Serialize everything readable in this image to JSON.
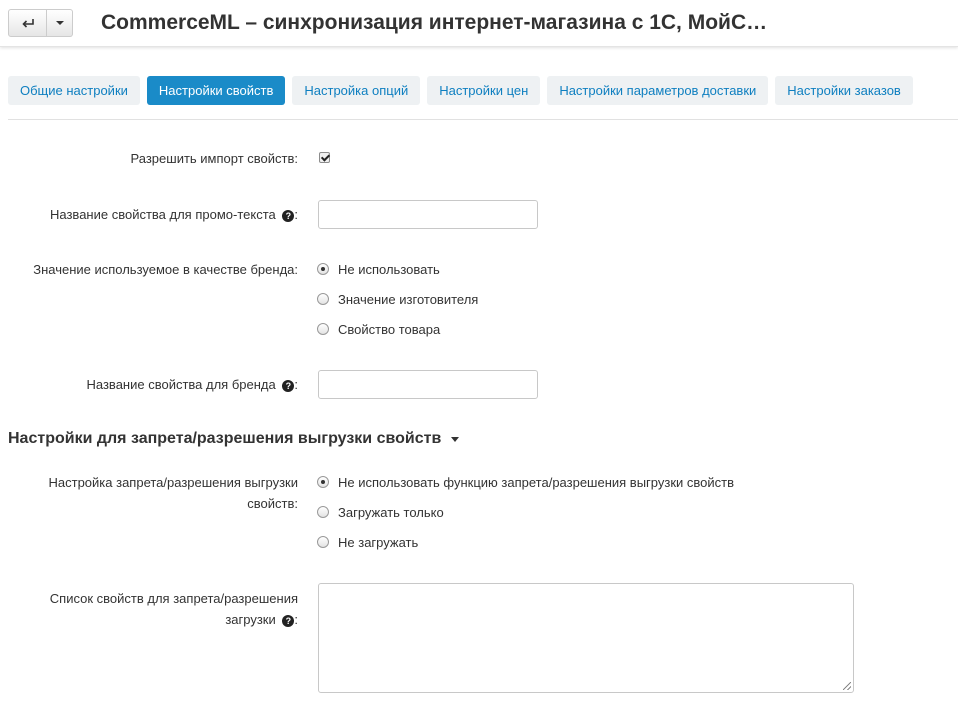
{
  "header": {
    "title": "CommerceML – синхронизация интернет-магазина с 1С, МойС…"
  },
  "tabs": [
    {
      "label": "Общие настройки",
      "active": false
    },
    {
      "label": "Настройки свойств",
      "active": true
    },
    {
      "label": "Настройка опций",
      "active": false
    },
    {
      "label": "Настройки цен",
      "active": false
    },
    {
      "label": "Настройки параметров доставки",
      "active": false
    },
    {
      "label": "Настройки заказов",
      "active": false
    }
  ],
  "form": {
    "allow_import": {
      "label": "Разрешить импорт свойств:",
      "checked": true
    },
    "promo_property": {
      "label": "Название свойства для промо-текста",
      "suffix": ":",
      "value": ""
    },
    "brand_value": {
      "label": "Значение используемое в качестве бренда:",
      "options": [
        "Не использовать",
        "Значение изготовителя",
        "Свойство товара"
      ],
      "selected": "Не использовать"
    },
    "brand_property": {
      "label": "Название свойства для бренда",
      "suffix": ":",
      "value": ""
    }
  },
  "section": {
    "heading": "Настройки для запрета/разрешения выгрузки свойств",
    "restriction_mode": {
      "label_line1": "Настройка запрета/разрешения выгрузки",
      "label_line2": "свойств:",
      "options": [
        "Не использовать функцию запрета/разрешения выгрузки свойств",
        "Загружать только",
        "Не загружать"
      ],
      "selected": "Не использовать функцию запрета/разрешения выгрузки свойств"
    },
    "property_list": {
      "label_line1": "Список свойств для запрета/разрешения",
      "label_line2": "загрузки",
      "suffix": ":",
      "value": ""
    }
  },
  "icons": {
    "back": "arrow-return-icon",
    "caret": "chevron-down-icon",
    "help": "question-circle-icon"
  },
  "colors": {
    "accent": "#1a8bc8",
    "tab_text": "#0e7fc0",
    "tab_bg": "#eef1f3"
  }
}
